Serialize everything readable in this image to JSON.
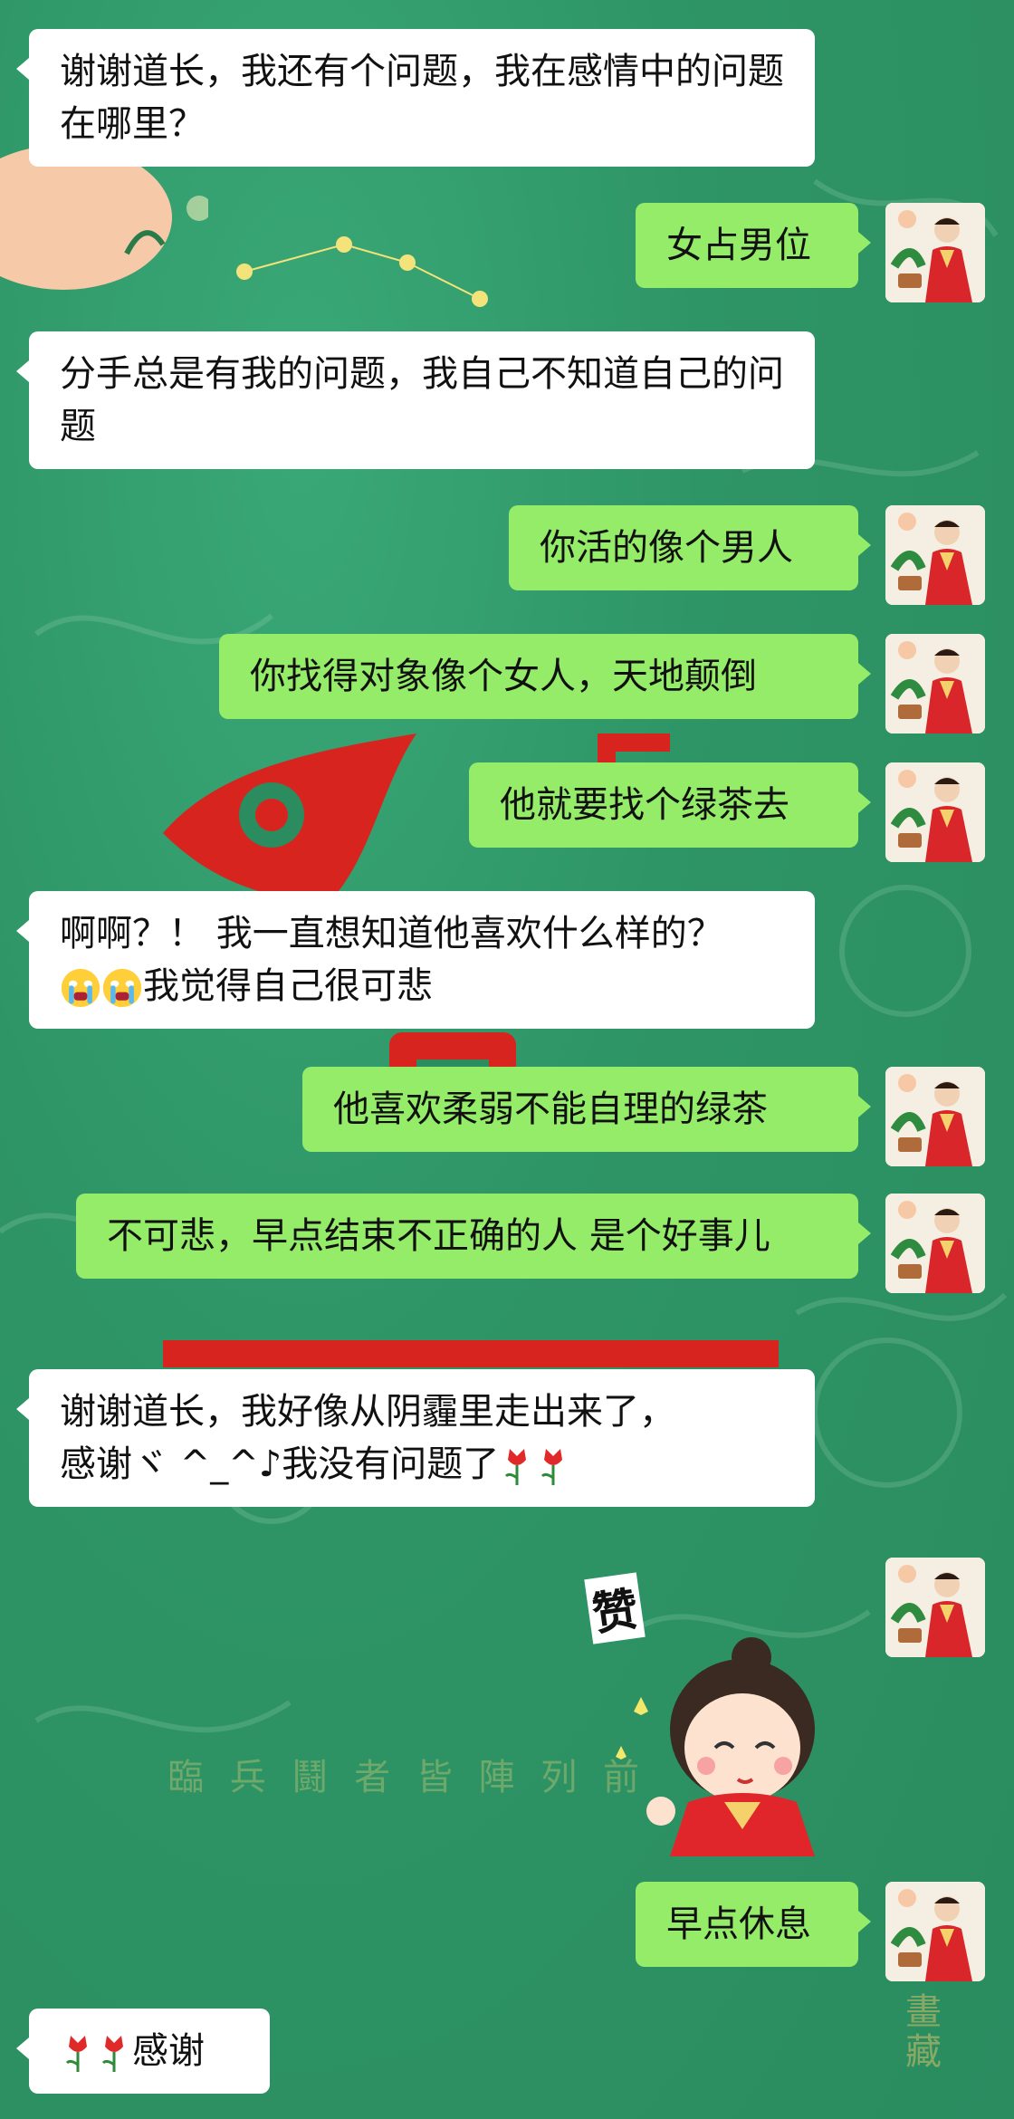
{
  "chat": {
    "messages": [
      {
        "side": "left",
        "text": "谢谢道长，我还有个问题，我在感情中的问题在哪里？"
      },
      {
        "side": "right",
        "text": "女占男位"
      },
      {
        "side": "left",
        "text": "分手总是有我的问题，我自己不知道自己的问题"
      },
      {
        "side": "right",
        "text": "你活的像个男人"
      },
      {
        "side": "right",
        "text": "你找得对象像个女人，天地颠倒"
      },
      {
        "side": "right",
        "text": "他就要找个绿茶去"
      },
      {
        "side": "left",
        "text": "啊啊？！ 我一直想知道他喜欢什么样的？",
        "text_after_emoji": "我觉得自己很可悲",
        "emoji": "crying-face-icon"
      },
      {
        "side": "right",
        "text": "他喜欢柔弱不能自理的绿茶"
      },
      {
        "side": "right",
        "text": "不可悲，早点结束不正确的人 是个好事儿"
      },
      {
        "side": "left",
        "text": "谢谢道长，我好像从阴霾里走出来了，",
        "line2": "感谢ヾ ^_^♪我没有问题了",
        "emoji": "tulip-icon"
      },
      {
        "side": "right",
        "type": "sticker",
        "sticker_text": "赞"
      },
      {
        "side": "right",
        "text": "早点休息"
      },
      {
        "side": "left",
        "text": "感谢",
        "emoji": "tulip-icon"
      }
    ]
  },
  "background": {
    "watermark_text": "臨 兵 鬪 者 皆 陣 列 前",
    "seal_text": "畫藏"
  },
  "colors": {
    "bg": "#2f9a6a",
    "left_bubble": "#ffffff",
    "right_bubble": "#95ec69"
  }
}
